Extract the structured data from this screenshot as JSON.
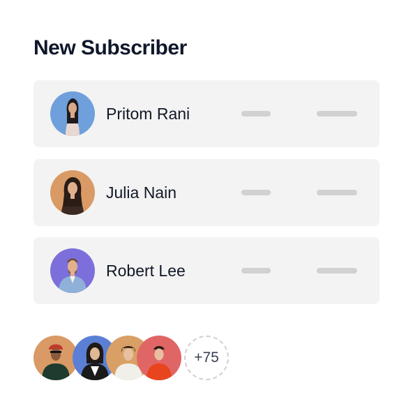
{
  "header": {
    "title": "New Subscriber"
  },
  "subscribers": [
    {
      "name": "Pritom Rani",
      "avatar_bg": "#6fa0dc"
    },
    {
      "name": "Julia Nain",
      "avatar_bg": "#d99a66"
    },
    {
      "name": "Robert Lee",
      "avatar_bg": "#7c6fdc"
    }
  ],
  "avatar_stack": {
    "avatars": [
      {
        "bg": "#d99a66"
      },
      {
        "bg": "#5b7fd4"
      },
      {
        "bg": "#d9a066"
      },
      {
        "bg": "#e06666"
      }
    ],
    "more_label": "+75"
  }
}
